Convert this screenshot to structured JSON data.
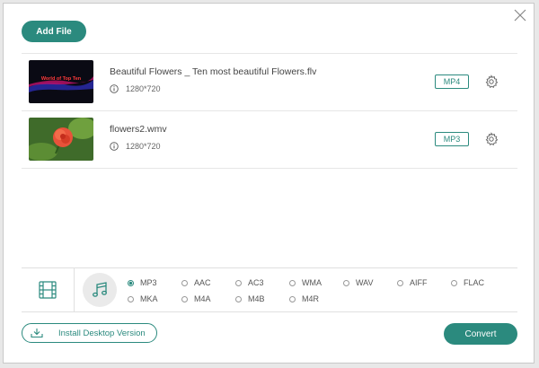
{
  "toolbar": {
    "add_file_label": "Add File"
  },
  "files": [
    {
      "name": "Beautiful Flowers _ Ten most beautiful Flowers.flv",
      "resolution": "1280*720",
      "format": "MP4",
      "thumb_text": "World of Top Ten"
    },
    {
      "name": "flowers2.wmv",
      "resolution": "1280*720",
      "format": "MP3"
    }
  ],
  "audio_formats": {
    "row1": [
      "MP3",
      "AAC",
      "AC3",
      "WMA",
      "WAV",
      "AIFF",
      "FLAC"
    ],
    "row2": [
      "MKA",
      "M4A",
      "M4B",
      "M4R"
    ],
    "selected": "MP3"
  },
  "footer": {
    "install_label": "Install Desktop Version",
    "convert_label": "Convert"
  },
  "colors": {
    "accent": "#2b8a7e"
  },
  "icons": [
    "close-icon",
    "info-icon",
    "gear-icon",
    "film-icon",
    "music-note-icon",
    "download-icon"
  ]
}
